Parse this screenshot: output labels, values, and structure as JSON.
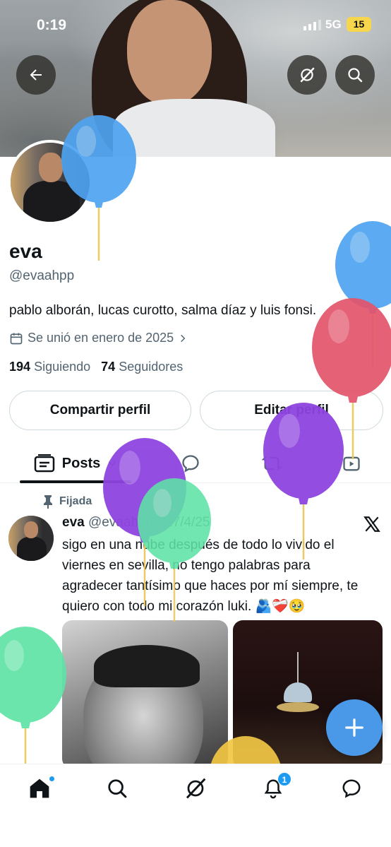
{
  "status_bar": {
    "time": "0:19",
    "network": "5G",
    "battery": "15"
  },
  "header_buttons": {
    "back_icon": "arrow-left-icon",
    "grok_icon": "grok-icon",
    "search_icon": "search-icon"
  },
  "profile": {
    "name": "eva",
    "handle": "@evaahpp",
    "bio": "pablo alborán, lucas curotto, salma díaz y luis fonsi.",
    "joined": "Se unió en enero de 2025",
    "following_count": "194",
    "following_label": "Siguiendo",
    "followers_count": "74",
    "followers_label": "Seguidores"
  },
  "actions": {
    "share": "Compartir perfil",
    "edit": "Editar perfil"
  },
  "tabs": {
    "posts": "Posts"
  },
  "post": {
    "pinned_label": "Fijada",
    "author": "eva",
    "meta": "@evaahpp · 27/4/25",
    "text": "sigo en una nube después de todo lo vivido el viernes en sevilla, no tengo palabras para agradecer tantísimo que haces por mí siempre, te quiero con todo mi corazón luki. 🫂❤️‍🩹🥹"
  },
  "notifications_badge": "1",
  "colors": {
    "accent": "#1d9bf0",
    "fab": "#4a99e9",
    "balloon_blue": "#4ea3f1",
    "balloon_red": "#e3546a",
    "balloon_purple": "#8e44e0",
    "balloon_green": "#5fe3a6",
    "balloon_yellow": "#f2c744"
  }
}
